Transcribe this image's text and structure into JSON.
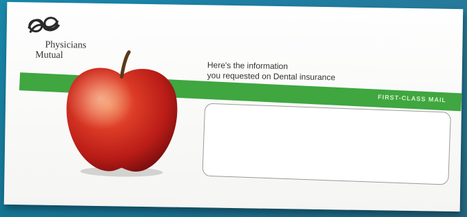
{
  "brand": {
    "name_line1": "Physicians",
    "name_line2": "Mutual"
  },
  "headline": {
    "line1": "Here's the information",
    "line2": "you requested on Dental insurance"
  },
  "postage": {
    "label": "FIRST-CLASS MAIL"
  },
  "colors": {
    "stripe": "#3fa640",
    "backdrop": "#1f86ad",
    "apple": "#c8231c"
  },
  "icons": [
    "physicians-mutual-logo-icon",
    "apple-icon"
  ]
}
